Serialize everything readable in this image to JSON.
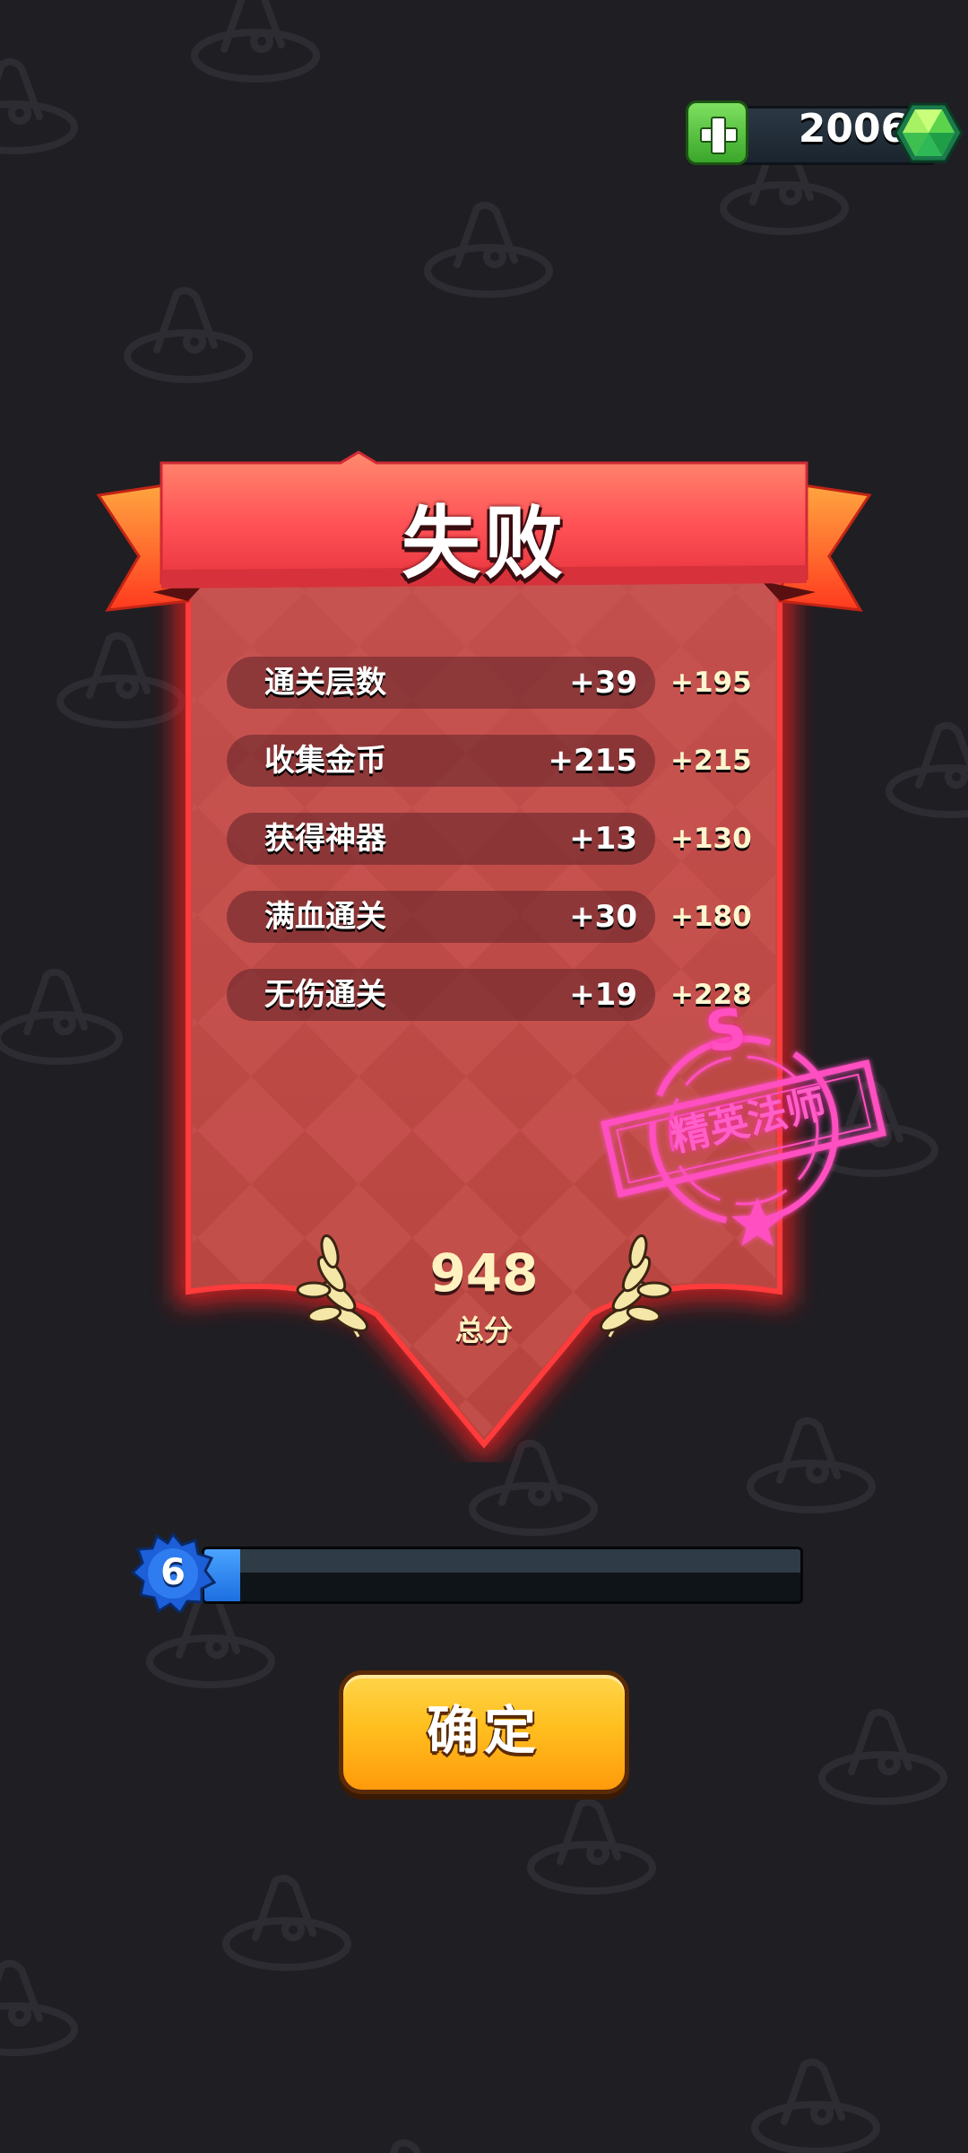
{
  "colors": {
    "background": "#1f1e23",
    "banner_red": "#c8484a",
    "ribbon": "#ff5a5c",
    "accent_gold": "#ffbf1f",
    "level_fill": "#2a86f4",
    "stamp_pink": "#ff5fc8"
  },
  "currency": {
    "gems": "2006",
    "add_icon": "plus-icon",
    "gem_icon": "green-gem-icon"
  },
  "result": {
    "title": "失败",
    "rows": [
      {
        "label": "通关层数",
        "value": "+39",
        "points": "+195"
      },
      {
        "label": "收集金币",
        "value": "+215",
        "points": "+215"
      },
      {
        "label": "获得神器",
        "value": "+13",
        "points": "+130"
      },
      {
        "label": "满血通关",
        "value": "+30",
        "points": "+180"
      },
      {
        "label": "无伤通关",
        "value": "+19",
        "points": "+228"
      }
    ],
    "total_score": "948",
    "total_label": "总分",
    "rank_stamp": {
      "letter": "S",
      "text": "精英法师"
    }
  },
  "level": {
    "number": "6",
    "progress": 0.06
  },
  "confirm_button": "确定"
}
